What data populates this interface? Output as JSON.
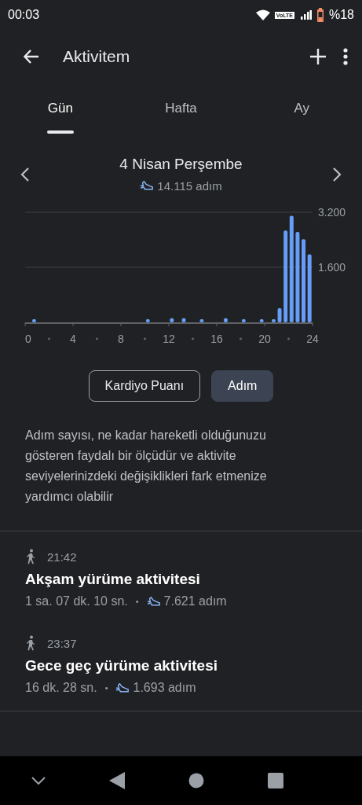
{
  "status_bar": {
    "time": "00:03",
    "network_badge": "VoLTE",
    "battery": "%18"
  },
  "toolbar": {
    "title": "Aktivitem"
  },
  "tabs": [
    {
      "label": "Gün",
      "selected": true
    },
    {
      "label": "Hafta",
      "selected": false
    },
    {
      "label": "Ay",
      "selected": false
    }
  ],
  "day": {
    "date": "4 Nisan Perşembe",
    "steps": "14.115 adım"
  },
  "chart_data": {
    "type": "bar",
    "x": [
      0.75,
      10.25,
      12.25,
      13.25,
      14.75,
      16.75,
      18.25,
      19.75,
      20.75,
      21.25,
      21.75,
      22.25,
      22.75,
      23.25,
      23.75
    ],
    "series": [
      {
        "color": "#669df6",
        "values": [
          90,
          90,
          120,
          120,
          90,
          120,
          90,
          90,
          90,
          410,
          2670,
          3100,
          2630,
          2420,
          1980
        ]
      }
    ],
    "xlim": [
      0,
      24
    ],
    "ylim": [
      0,
      3200
    ],
    "xticks": [
      0,
      4,
      8,
      12,
      16,
      20,
      24
    ],
    "yticks": [
      {
        "value": 1600,
        "label": "1.600"
      },
      {
        "value": 3200,
        "label": "3.200"
      }
    ]
  },
  "metric_toggle": [
    {
      "label": "Kardiyo Puanı",
      "selected": false
    },
    {
      "label": "Adım",
      "selected": true
    }
  ],
  "description": "Adım sayısı, ne kadar hareketli olduğunuzu gösteren faydalı bir ölçüdür ve aktivite seviyelerinizdeki değişiklikleri fark etmenize yardımcı olabilir",
  "activities": [
    {
      "time": "21:42",
      "title": "Akşam yürüme aktivitesi",
      "duration": "1 sa. 07 dk. 10 sn.",
      "separator": "•",
      "steps": "7.621 adım"
    },
    {
      "time": "23:37",
      "title": "Gece geç yürüme aktivitesi",
      "duration": "16 dk. 28 sn.",
      "separator": "•",
      "steps": "1.693 adım"
    }
  ]
}
